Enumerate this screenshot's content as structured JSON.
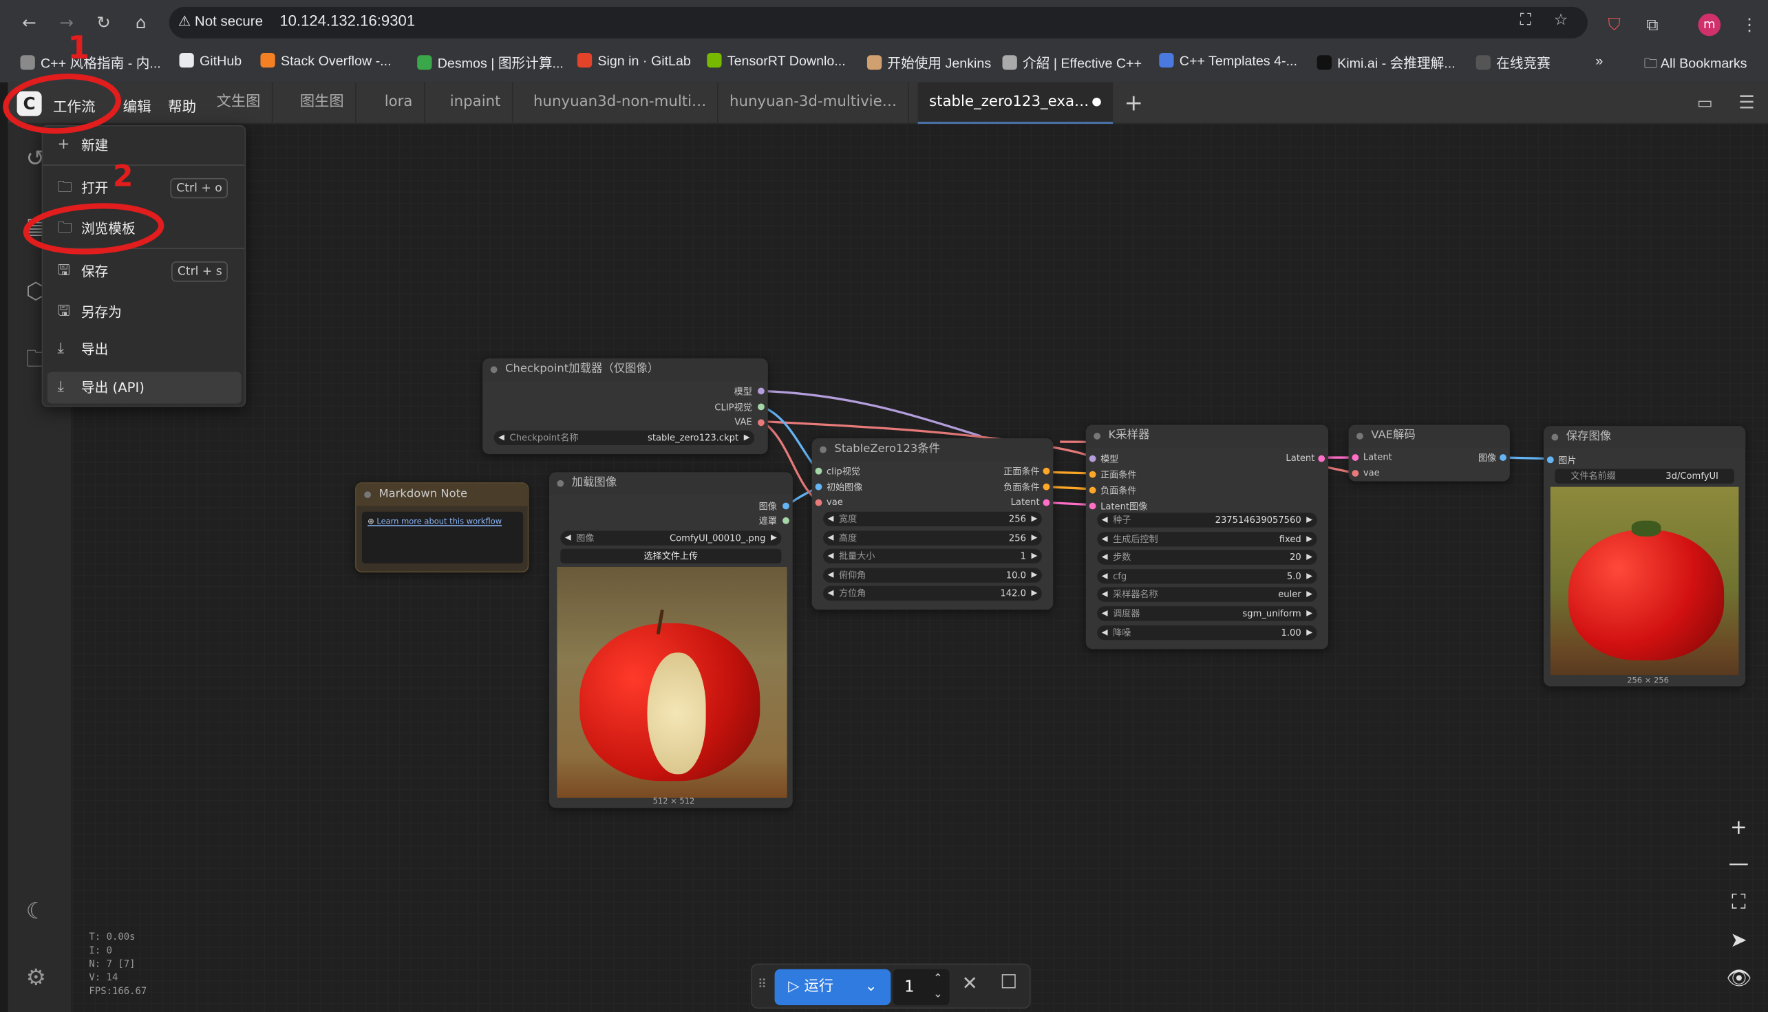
{
  "browser": {
    "security": "Not secure",
    "url": "10.124.132.16:9301",
    "avatar_letter": "m",
    "bookmarks": [
      {
        "label": "C++ 风格指南 - 内...",
        "color": "#8a8a8a"
      },
      {
        "label": "GitHub",
        "color": "#e8eaed"
      },
      {
        "label": "Stack Overflow -...",
        "color": "#f48024"
      },
      {
        "label": "Desmos | 图形计算...",
        "color": "#3aa84a"
      },
      {
        "label": "Sign in · GitLab",
        "color": "#e24329"
      },
      {
        "label": "TensorRT Downlo...",
        "color": "#76b900"
      },
      {
        "label": "开始使用 Jenkins",
        "color": "#d0a070"
      },
      {
        "label": "介紹 | Effective C++",
        "color": "#aaaaaa"
      },
      {
        "label": "C++ Templates 4-...",
        "color": "#4a7ae0"
      },
      {
        "label": "Kimi.ai - 会推理解...",
        "color": "#111111"
      },
      {
        "label": "在线竞赛",
        "color": "#555555"
      }
    ],
    "more": "»",
    "all_bookmarks": "All Bookmarks"
  },
  "topbar": {
    "logo": "C",
    "menus": [
      "工作流",
      "编辑",
      "帮助"
    ],
    "tabs": [
      "文生图",
      "图生图",
      "lora",
      "inpaint",
      "hunyuan3d-non-multi…",
      "hunyuan-3d-multivie…",
      "stable_zero123_exa…"
    ],
    "active_tab_dot": "●",
    "add_tab": "+"
  },
  "workflow_menu": {
    "items": [
      {
        "icon": "+",
        "label": "新建",
        "shortcut": ""
      },
      {
        "icon": "🗀",
        "label": "打开",
        "shortcut": "Ctrl + o"
      },
      {
        "icon": "🗀",
        "label": "浏览模板",
        "shortcut": ""
      },
      {
        "icon": "🖫",
        "label": "保存",
        "shortcut": "Ctrl + s"
      },
      {
        "icon": "🖫",
        "label": "另存为",
        "shortcut": ""
      },
      {
        "icon": "⤓",
        "label": "导出",
        "shortcut": ""
      },
      {
        "icon": "⤓",
        "label": "导出 (API)",
        "shortcut": ""
      }
    ]
  },
  "annotations": {
    "mark1": "1",
    "mark2": "2",
    "color": "#e11d1d"
  },
  "nodes": {
    "checkpoint": {
      "title": "Checkpoint加载器（仅图像）",
      "outputs": [
        "模型",
        "CLIP视觉",
        "VAE"
      ],
      "widget_label": "Checkpoint名称",
      "widget_value": "stable_zero123.ckpt"
    },
    "markdown": {
      "title": "Markdown Note",
      "link": "Learn more about this workflow"
    },
    "load_image": {
      "title": "加载图像",
      "outputs": [
        "图像",
        "遮罩"
      ],
      "widget_label": "图像",
      "widget_value": "ComfyUI_00010_.png",
      "upload": "选择文件上传",
      "size": "512 × 512"
    },
    "sz123": {
      "title": "StableZero123条件",
      "inputs": [
        "clip视觉",
        "初始图像",
        "vae"
      ],
      "outputs": [
        "正面条件",
        "负面条件",
        "Latent"
      ],
      "widgets": [
        {
          "label": "宽度",
          "value": "256"
        },
        {
          "label": "高度",
          "value": "256"
        },
        {
          "label": "批量大小",
          "value": "1"
        },
        {
          "label": "俯仰角",
          "value": "10.0"
        },
        {
          "label": "方位角",
          "value": "142.0"
        }
      ]
    },
    "ksampler": {
      "title": "K采样器",
      "inputs": [
        "模型",
        "正面条件",
        "负面条件",
        "Latent图像"
      ],
      "output": "Latent",
      "widgets": [
        {
          "label": "种子",
          "value": "237514639057560"
        },
        {
          "label": "生成后控制",
          "value": "fixed"
        },
        {
          "label": "步数",
          "value": "20"
        },
        {
          "label": "cfg",
          "value": "5.0"
        },
        {
          "label": "采样器名称",
          "value": "euler"
        },
        {
          "label": "调度器",
          "value": "sgm_uniform"
        },
        {
          "label": "降噪",
          "value": "1.00"
        }
      ]
    },
    "vae_decode": {
      "title": "VAE解码",
      "inputs": [
        "Latent",
        "vae"
      ],
      "output": "图像"
    },
    "save_image": {
      "title": "保存图像",
      "input": "图片",
      "widget_label": "文件名前缀",
      "widget_value": "3d/ComfyUI",
      "size": "256 × 256"
    }
  },
  "runbar": {
    "run_label": "运行",
    "count": "1"
  },
  "stats": [
    "T: 0.00s",
    "I: 0",
    "N: 7 [7]",
    "V: 14",
    "FPS:166.67"
  ],
  "colors": {
    "run": "#2f7be0",
    "link_model": "#b39ddb",
    "link_clip": "#e87a7a",
    "link_image": "#64b5f6",
    "link_cond": "#ffa726",
    "link_latent": "#ff6ec7"
  }
}
